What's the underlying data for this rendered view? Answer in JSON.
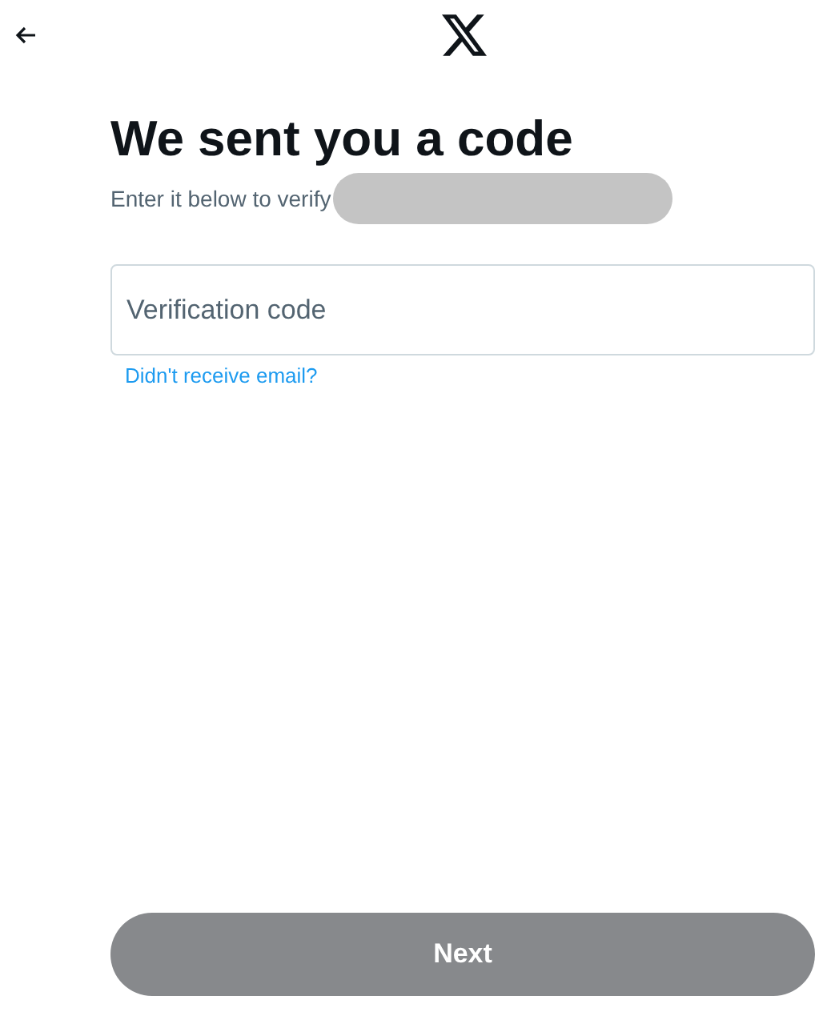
{
  "heading": "We sent you a code",
  "subtitle": "Enter it below to verify",
  "code_field": {
    "placeholder": "Verification code"
  },
  "resend_link": "Didn't receive email?",
  "next_button": {
    "label": "Next",
    "disabled": true
  }
}
